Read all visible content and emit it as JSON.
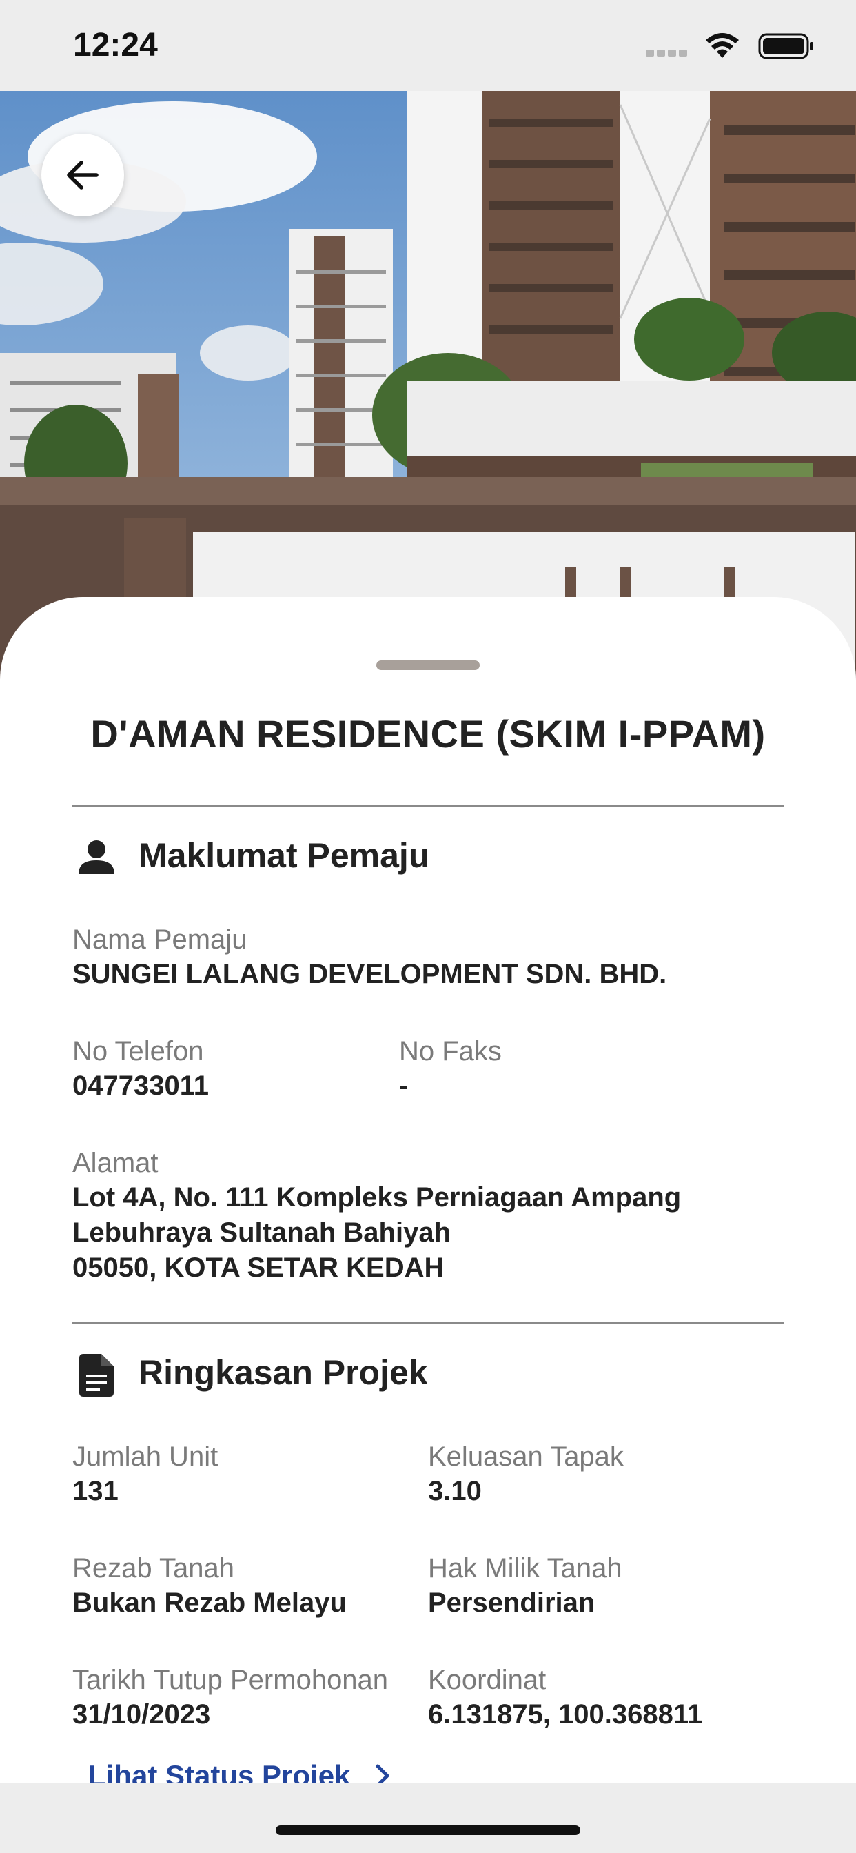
{
  "status_bar": {
    "time": "12:24"
  },
  "navigation": {
    "back_icon": "arrow-left-icon"
  },
  "project": {
    "title": "D'AMAN RESIDENCE (SKIM I-PPAM)"
  },
  "developer_section": {
    "icon": "person-icon",
    "heading": "Maklumat Pemaju",
    "name_label": "Nama Pemaju",
    "name_value": "SUNGEI LALANG DEVELOPMENT SDN. BHD.",
    "phone_label": "No Telefon",
    "phone_value": "047733011",
    "fax_label": "No Faks",
    "fax_value": "-",
    "address_label": "Alamat",
    "address_lines": [
      "Lot 4A, No. 111 Kompleks Perniagaan Ampang",
      "Lebuhraya Sultanah Bahiyah",
      "05050, KOTA SETAR KEDAH"
    ]
  },
  "summary_section": {
    "icon": "document-icon",
    "heading": "Ringkasan Projek",
    "units_label": "Jumlah Unit",
    "units_value": "131",
    "site_area_label": "Keluasan Tapak",
    "site_area_value": "3.10",
    "land_reserve_label": "Rezab Tanah",
    "land_reserve_value": "Bukan Rezab Melayu",
    "ownership_label": "Hak Milik Tanah",
    "ownership_value": "Persendirian",
    "closing_date_label": "Tarikh Tutup Permohonan",
    "closing_date_value": "31/10/2023",
    "coordinates_label": "Koordinat",
    "coordinates_value": "6.131875, 100.368811"
  },
  "status_link": {
    "label": "Lihat Status Projek",
    "icon": "chevron-right-icon"
  }
}
